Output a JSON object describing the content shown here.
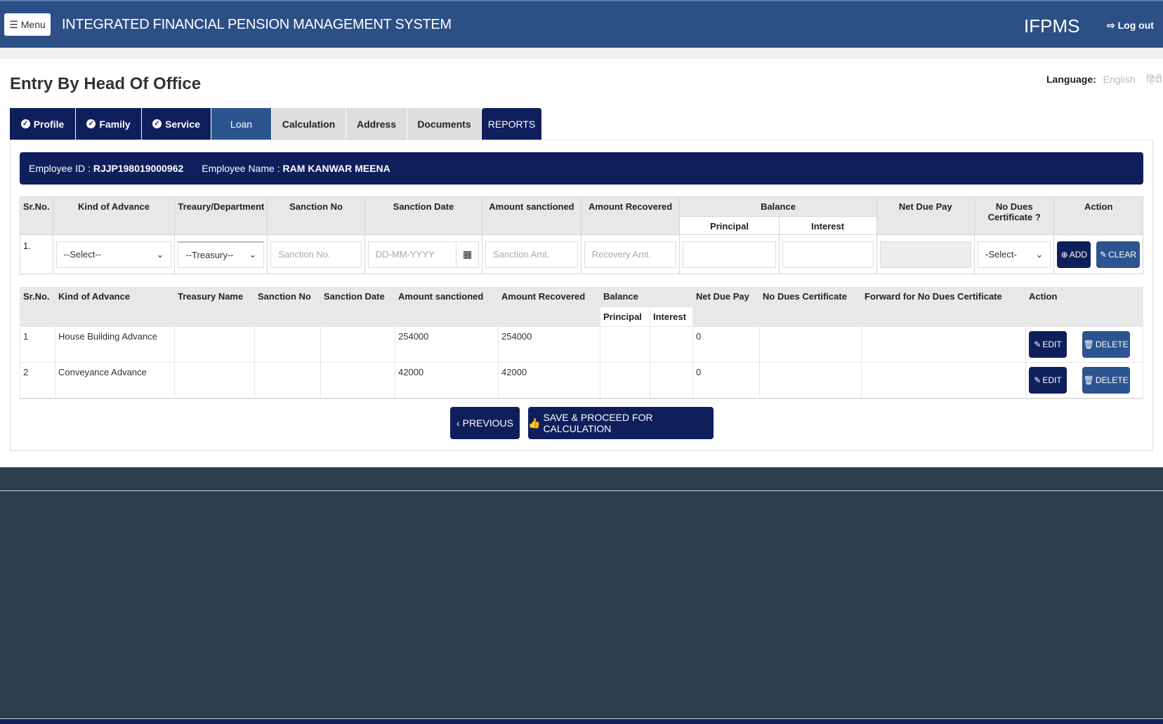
{
  "header": {
    "menu_label": "Menu",
    "app_title": "INTEGRATED FINANCIAL PENSION MANAGEMENT SYSTEM",
    "brand": "IFPMS",
    "logout_label": "Log out"
  },
  "page": {
    "title": "Entry By Head Of Office",
    "language_label": "Language:",
    "language_options": [
      "English",
      "हिंदी"
    ]
  },
  "tabs": [
    {
      "label": "Profile",
      "state": "completed"
    },
    {
      "label": "Family",
      "state": "completed"
    },
    {
      "label": "Service",
      "state": "completed"
    },
    {
      "label": "Loan",
      "state": "active"
    },
    {
      "label": "Calculation",
      "state": "pending"
    },
    {
      "label": "Address",
      "state": "pending"
    },
    {
      "label": "Documents",
      "state": "pending"
    },
    {
      "label": "REPORTS",
      "state": "link"
    }
  ],
  "employee": {
    "id_label": "Employee ID :",
    "id": "RJJP198019000962",
    "name_label": "Employee Name :",
    "name": "RAM KANWAR MEENA"
  },
  "entry_form": {
    "headers": {
      "sr": "Sr.No.",
      "kind": "Kind of Advance",
      "treasury": "Treaury/Department",
      "sanction_no": "Sanction No",
      "sanction_date": "Sanction Date",
      "amount_sanctioned": "Amount sanctioned",
      "amount_recovered": "Amount Recovered",
      "balance": "Balance",
      "principal": "Principal",
      "interest": "Interest",
      "net_due": "Net Due Pay",
      "no_dues": "No Dues Certificate ?",
      "action": "Action"
    },
    "row": {
      "sr": "1.",
      "kind_selected": "--Select--",
      "treasury_selected": "--Treasury--",
      "sanction_no_placeholder": "Sanction No.",
      "sanction_date_placeholder": "DD-MM-YYYY",
      "sanction_amt_placeholder": "Sanction Amt.",
      "recovery_amt_placeholder": "Recovery Amt.",
      "principal_value": "",
      "interest_value": "",
      "net_due_value": "",
      "no_dues_selected": "-Select-"
    },
    "add_label": "ADD",
    "clear_label": "CLEAR"
  },
  "loans_table": {
    "headers": {
      "sr": "Sr.No.",
      "kind": "Kind of Advance",
      "treasury": "Treasury Name",
      "sanction_no": "Sanction No",
      "sanction_date": "Sanction Date",
      "amount_sanctioned": "Amount sanctioned",
      "amount_recovered": "Amount Recovered",
      "balance": "Balance",
      "principal": "Principal",
      "interest": "Interest",
      "net_due": "Net Due Pay",
      "no_dues": "No Dues Certificate",
      "forward": "Forward for No Dues Certificate",
      "action": "Action"
    },
    "rows": [
      {
        "sr": "1",
        "kind": "House Building Advance",
        "treasury": "",
        "sanction_no": "",
        "sanction_date": "",
        "amount_sanctioned": "254000",
        "amount_recovered": "254000",
        "principal": "",
        "interest": "",
        "net_due": "0",
        "no_dues": "",
        "forward": ""
      },
      {
        "sr": "2",
        "kind": "Conveyance Advance",
        "treasury": "",
        "sanction_no": "",
        "sanction_date": "",
        "amount_sanctioned": "42000",
        "amount_recovered": "42000",
        "principal": "",
        "interest": "",
        "net_due": "0",
        "no_dues": "",
        "forward": ""
      }
    ],
    "edit_label": "EDIT",
    "delete_label": "DELETE"
  },
  "navigation": {
    "previous_label": "PREVIOUS",
    "save_label": "SAVE & PROCEED FOR CALCULATION"
  },
  "colors": {
    "header_blue": "#2c4f86",
    "navy": "#0f1f5c",
    "active_tab": "#2c5590",
    "footer": "#2f3e4e"
  }
}
